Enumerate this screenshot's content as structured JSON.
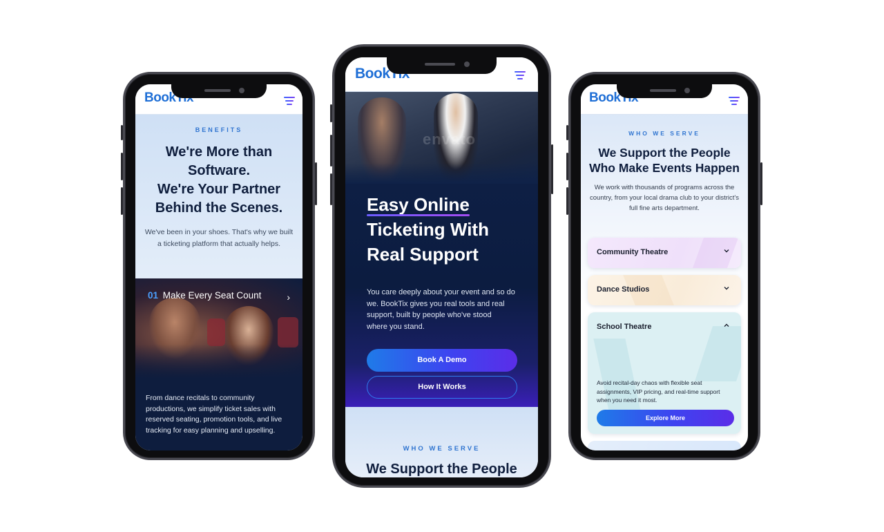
{
  "brand": {
    "logo": "BookTix",
    "accent": "#1f6fd6",
    "gradient_start": "#1f7be8",
    "gradient_end": "#5b2de8"
  },
  "phone1": {
    "eyebrow": "BENEFITS",
    "title_line1": "We're More than",
    "title_line2": "Software.",
    "title_line3": "We're Your Partner",
    "title_line4": "Behind the Scenes.",
    "intro_line1": "We've been in your shoes. That's why we built",
    "intro_line2": "a ticketing platform that actually helps.",
    "feature_number": "01",
    "feature_title": "Make Every Seat Count",
    "feature_line1": "From dance recitals to community",
    "feature_line2": "productions, we simplify ticket sales with",
    "feature_line3": "reserved seating, promotion tools, and live",
    "feature_line4": "tracking for easy planning and upselling."
  },
  "phone2": {
    "hero_line1": "Easy Online",
    "hero_line2": "Ticketing With",
    "hero_line3": "Real Support",
    "hero_watermark": "envato",
    "desc_line1": "You care deeply about your event and so do",
    "desc_line2": "we. BookTix gives you real tools and real",
    "desc_line3": "support, built by people who've stood",
    "desc_line4": "where you stand.",
    "primary_cta": "Book A Demo",
    "secondary_cta": "How It Works",
    "eyebrow": "WHO WE SERVE",
    "section_title": "We Support the People"
  },
  "phone3": {
    "eyebrow": "WHO WE SERVE",
    "title_line1": "We Support the People",
    "title_line2": "Who Make Events Happen",
    "intro_line1": "We work with thousands of programs across the",
    "intro_line2": "country, from your local drama club to your district's",
    "intro_line3": "full fine arts department.",
    "accordion": [
      {
        "label": "Community Theatre",
        "state": "collapsed",
        "color": "#f3e6fb"
      },
      {
        "label": "Dance Studios",
        "state": "collapsed",
        "color": "#fbf1e3"
      },
      {
        "label": "School Theatre",
        "state": "expanded",
        "color": "#dff1f4",
        "body_line1": "Avoid recital-day chaos with flexible seat",
        "body_line2": "assignments, VIP pricing, and real-time support",
        "body_line3": "when you need it most.",
        "cta": "Explore More"
      }
    ]
  }
}
